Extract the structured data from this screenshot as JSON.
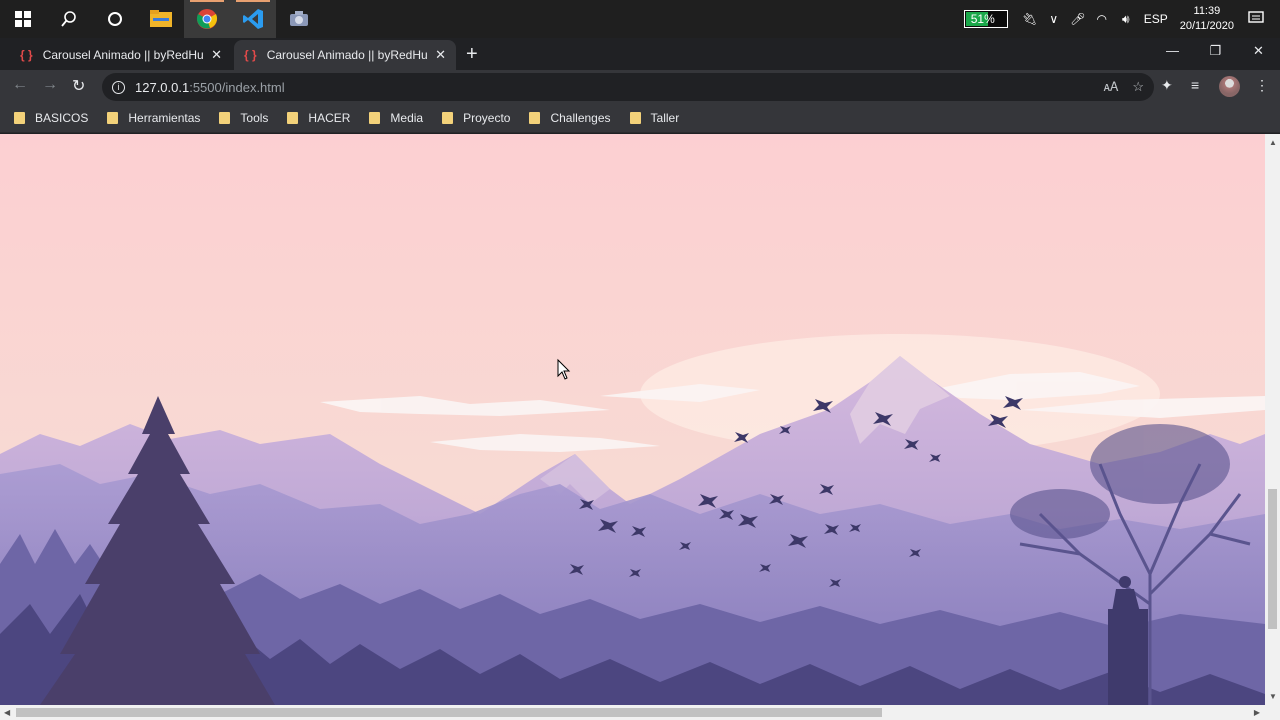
{
  "taskbar": {
    "icons": [
      "windows-icon",
      "search-icon",
      "cortana-icon",
      "file-explorer-icon",
      "chrome-icon",
      "vscode-icon",
      "app-icon"
    ],
    "battery": "51%",
    "language": "ESP",
    "time": "11:39",
    "date": "20/11/2020"
  },
  "tabs": [
    {
      "favicon": "{ }",
      "title": "Carousel Animado || byRedHunter"
    },
    {
      "favicon": "{ }",
      "title": "Carousel Animado || byRedHunter"
    }
  ],
  "address": {
    "host": "127.0.0.1",
    "path": ":5500/index.html"
  },
  "bookmarks": [
    "BASICOS",
    "Herramientas",
    "Tools",
    "HACER",
    "Media",
    "Proyecto",
    "Challenges",
    "Taller"
  ],
  "colors": {
    "sky_top": "#fccfd2",
    "sky_bottom": "#f6d8cf",
    "mountain_far": "#b39ed0",
    "mountain_mid": "#8e83bd",
    "forest": "#5c5591",
    "forest_dark": "#3d3a6a"
  }
}
